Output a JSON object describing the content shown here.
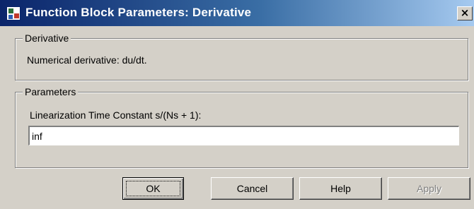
{
  "window": {
    "title": "Function Block Parameters: Derivative",
    "close_glyph": "×"
  },
  "block_group": {
    "legend": "Derivative",
    "description": "Numerical derivative:  du/dt."
  },
  "params_group": {
    "legend": "Parameters",
    "field_label": "Linearization Time Constant s/(Ns + 1):",
    "field_value": "inf"
  },
  "buttons": {
    "ok": "OK",
    "cancel": "Cancel",
    "help": "Help",
    "apply": "Apply"
  },
  "colors": {
    "dialog_face": "#d4d0c8",
    "titlebar_start": "#0a246a",
    "titlebar_end": "#a6caf0"
  }
}
